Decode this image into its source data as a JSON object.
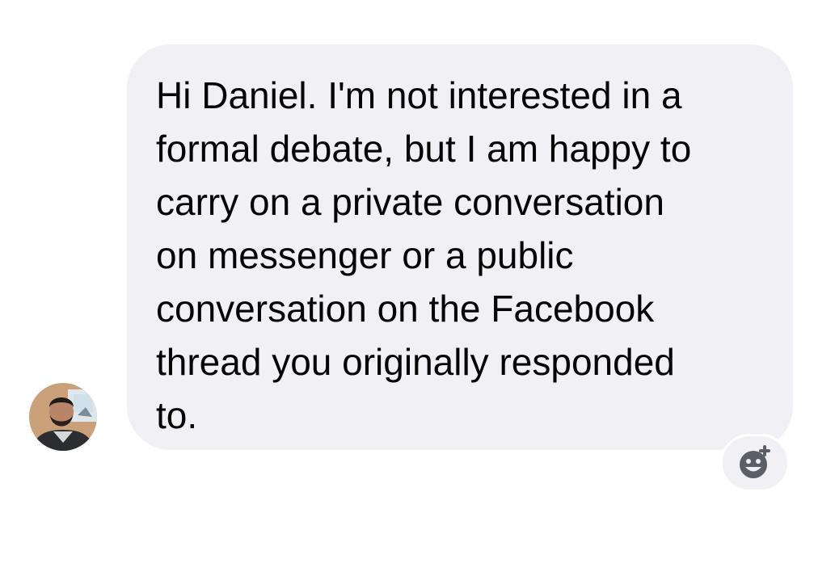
{
  "message": {
    "lines": [
      "Hi Daniel. I'm not interested in a",
      "formal debate, but I am happy to",
      "carry on a private conversation",
      "on messenger or a public",
      "conversation on the Facebook",
      "thread you originally responded",
      "to."
    ]
  },
  "icons": {
    "avatar": "sender-avatar-photo",
    "reaction": "add-reaction-icon"
  },
  "colors": {
    "bubble_background": "#f0f0f5",
    "text": "#050505",
    "reaction_icon": "#5b5e66"
  }
}
